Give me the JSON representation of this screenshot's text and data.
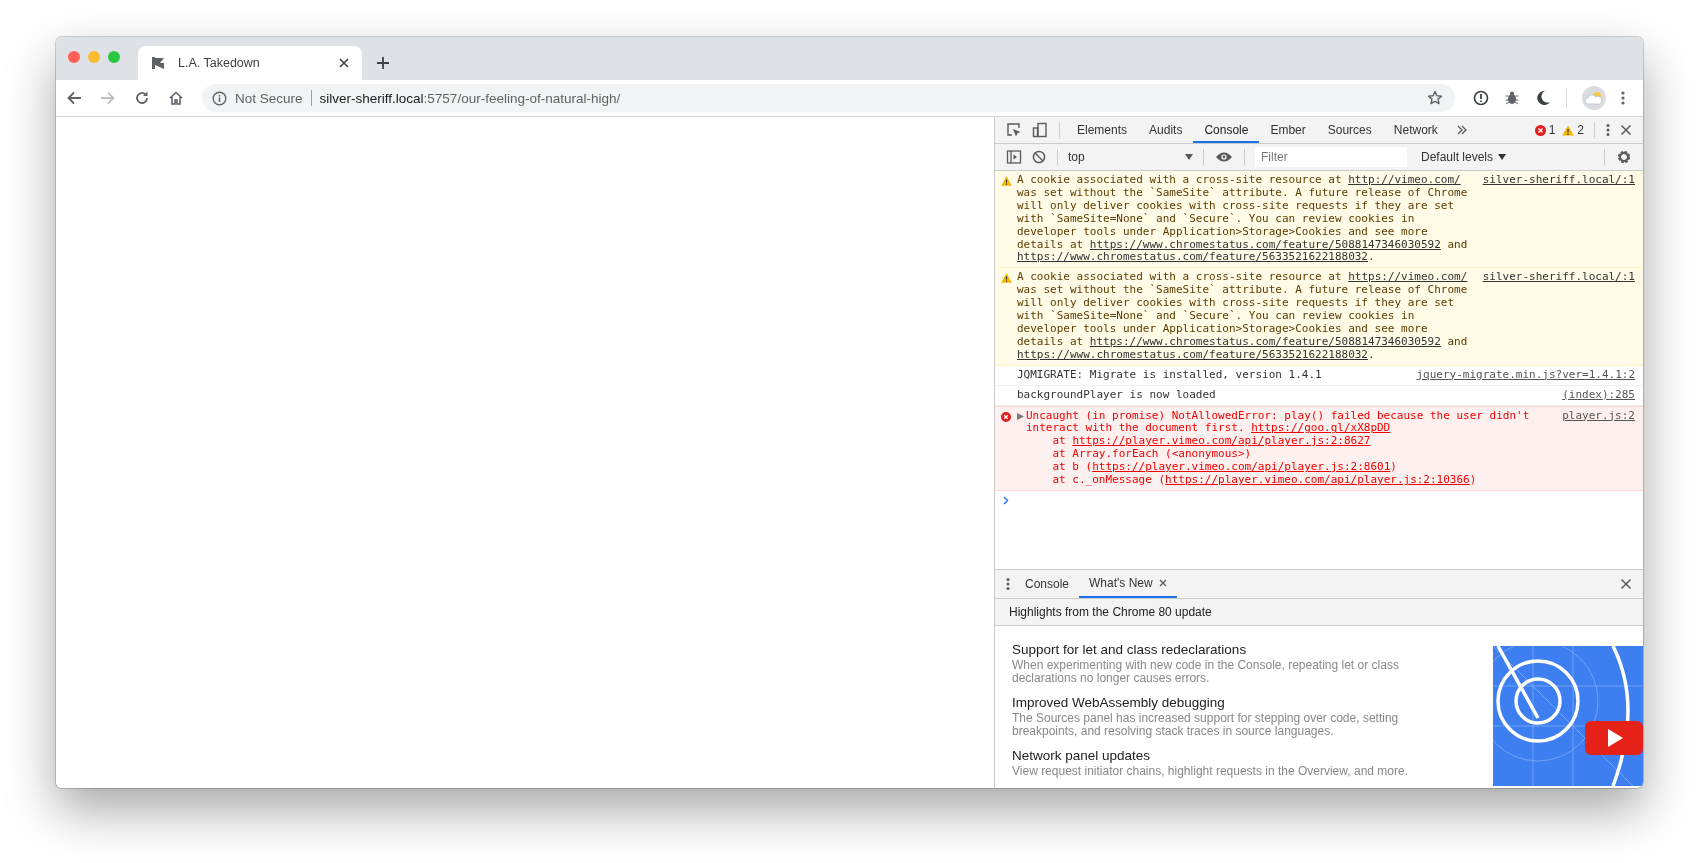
{
  "browser": {
    "tab": {
      "title": "L.A. Takedown"
    },
    "forward_button": {
      "disabled": true
    },
    "address_bar": {
      "security": "Not Secure",
      "host": "silver-sheriff.local",
      "path": ":5757/our-feeling-of-natural-high/"
    }
  },
  "devtools": {
    "tabs": [
      {
        "label": "Elements",
        "selected": false
      },
      {
        "label": "Audits",
        "selected": false
      },
      {
        "label": "Console",
        "selected": true
      },
      {
        "label": "Ember",
        "selected": false
      },
      {
        "label": "Sources",
        "selected": false
      },
      {
        "label": "Network",
        "selected": false
      }
    ],
    "error_count": "1",
    "warning_count": "2",
    "console_toolbar": {
      "context": "top",
      "filter": {
        "placeholder": "Filter"
      },
      "levels": "Default levels"
    },
    "messages": [
      {
        "kind": "warning",
        "source": "silver-sheriff.local/:1",
        "segments": [
          {
            "text": "A cookie associated with a cross-site resource at ",
            "link": false
          },
          {
            "text": "http://vimeo.com/",
            "link": true
          },
          {
            "text": " was set without the `SameSite` attribute. A future release of Chrome will only deliver cookies with cross-site requests if they are set with `SameSite=None` and `Secure`. You can review cookies in developer tools under Application>Storage>Cookies and see more details at ",
            "link": false
          },
          {
            "text": "https://www.chromestatus.com/feature/5088147346030592",
            "link": true
          },
          {
            "text": " and ",
            "link": false
          },
          {
            "text": "https://www.chromestatus.com/feature/5633521622188032",
            "link": true
          },
          {
            "text": ".",
            "link": false
          }
        ]
      },
      {
        "kind": "warning",
        "source": "silver-sheriff.local/:1",
        "segments": [
          {
            "text": "A cookie associated with a cross-site resource at ",
            "link": false
          },
          {
            "text": "https://vimeo.com/",
            "link": true
          },
          {
            "text": " was set without the `SameSite` attribute. A future release of Chrome will only deliver cookies with cross-site requests if they are set with `SameSite=None` and `Secure`. You can review cookies in developer tools under Application>Storage>Cookies and see more details at ",
            "link": false
          },
          {
            "text": "https://www.chromestatus.com/feature/5088147346030592",
            "link": true
          },
          {
            "text": " and ",
            "link": false
          },
          {
            "text": "https://www.chromestatus.com/feature/5633521622188032",
            "link": true
          },
          {
            "text": ".",
            "link": false
          }
        ]
      },
      {
        "kind": "info",
        "source": "jquery-migrate.min.js?ver=1.4.1:2",
        "segments": [
          {
            "text": "JQMIGRATE: Migrate is installed, version 1.4.1",
            "link": false
          }
        ]
      },
      {
        "kind": "info",
        "source": "(index):285",
        "segments": [
          {
            "text": "backgroundPlayer is now loaded",
            "link": false
          }
        ]
      },
      {
        "kind": "error",
        "expanded": false,
        "source": "player.js:2",
        "segments": [
          {
            "text": "Uncaught (in promise) NotAllowedError: play() failed because the user didn't interact with the document first. ",
            "link": false
          },
          {
            "text": "https://goo.gl/xX8pDD",
            "link": true
          },
          {
            "text": "\n    at ",
            "link": false
          },
          {
            "text": "https://player.vimeo.com/api/player.js:2:8627",
            "link": true
          },
          {
            "text": "\n    at Array.forEach (<anonymous>)\n    at b (",
            "link": false
          },
          {
            "text": "https://player.vimeo.com/api/player.js:2:8601",
            "link": true
          },
          {
            "text": ")\n    at c._onMessage (",
            "link": false
          },
          {
            "text": "https://player.vimeo.com/api/player.js:2:10366",
            "link": true
          },
          {
            "text": ")",
            "link": false
          }
        ]
      }
    ],
    "drawer": {
      "tabs": [
        {
          "label": "Console",
          "selected": false,
          "closable": false
        },
        {
          "label": "What's New",
          "selected": true,
          "closable": true
        }
      ],
      "banner": "Highlights from the Chrome 80 update",
      "articles": [
        {
          "title": "Support for let and class redeclarations",
          "description": "When experimenting with new code in the Console, repeating let or class declarations no longer causes errors."
        },
        {
          "title": "Improved WebAssembly debugging",
          "description": "The Sources panel has increased support for stepping over code, setting breakpoints, and resolving stack traces in source languages."
        },
        {
          "title": "Network panel updates",
          "description": "View request initiator chains, highlight requests in the Overview, and more."
        }
      ]
    }
  }
}
